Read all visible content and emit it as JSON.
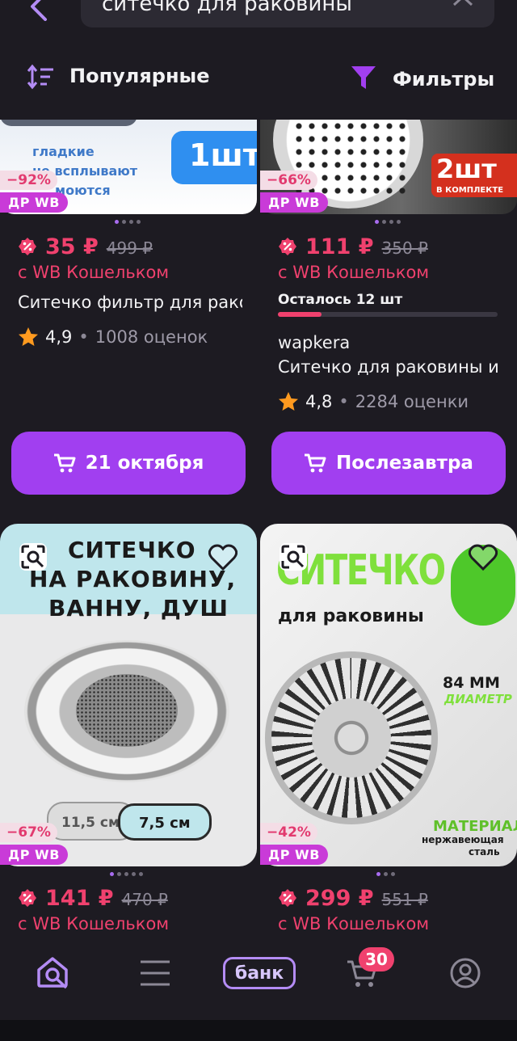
{
  "search": {
    "query": "ситечко для раковины"
  },
  "sortbar": {
    "sort_label": "Популярные",
    "filter_label": "Фильтры"
  },
  "products": [
    {
      "discount": "−92%",
      "badge": "ДР WB",
      "image_text": {
        "line1": "гладкие",
        "line2": "не всплывают",
        "line3": "моются",
        "pack": "1шт"
      },
      "price": "35 ₽",
      "old_price": "499 ₽",
      "wallet": "с WB Кошельком",
      "title": "Ситечко фильтр для раковины",
      "rating": "4,9",
      "rating_sep": "•",
      "reviews": "1008 оценок",
      "button": "21 октября"
    },
    {
      "discount": "−66%",
      "badge": "ДР WB",
      "image_text": {
        "pack": "2шт",
        "pack_sub": "В КОМПЛЕКТЕ"
      },
      "price": "111 ₽",
      "old_price": "350 ₽",
      "wallet": "с WB Кошельком",
      "stock": "Осталось 12 шт",
      "stock_fraction": 0.2,
      "brand": "wapkera",
      "title": "Ситечко для раковины и ванны",
      "rating": "4,8",
      "rating_sep": "•",
      "reviews": "2284 оценки",
      "button": "Послезавтра"
    },
    {
      "discount": "−67%",
      "badge": "ДР WB",
      "image_text": {
        "line1": "СИТЕЧКО",
        "line2": "НА РАКОВИНУ,",
        "line3": "ВАННУ, ДУШ",
        "size1": "11,5 см",
        "size2": "7,5 см"
      },
      "price": "141 ₽",
      "old_price": "470 ₽",
      "wallet": "с WB Кошельком"
    },
    {
      "discount": "−42%",
      "badge": "ДР WB",
      "image_text": {
        "line1": "СИТЕЧКО",
        "line2": "для раковины",
        "size": "84 ММ",
        "size_sub": "ДИАМЕТР",
        "material": "МАТЕРИАЛ",
        "material_sub1": "нержавеющая",
        "material_sub2": "сталь"
      },
      "price": "299 ₽",
      "old_price": "551 ₽",
      "wallet": "с WB Кошельком"
    }
  ],
  "bottomnav": {
    "bank_label": "банк",
    "cart_count": "30"
  },
  "colors": {
    "accent": "#a13ff0",
    "price": "#f0416e",
    "background": "#1d1b22"
  },
  "icons": [
    "back-arrow-icon",
    "clear-icon",
    "sort-icon",
    "filter-icon",
    "discount-icon",
    "star-icon",
    "cart-icon",
    "image-search-icon",
    "heart-icon",
    "home-icon",
    "menu-icon",
    "profile-icon"
  ]
}
